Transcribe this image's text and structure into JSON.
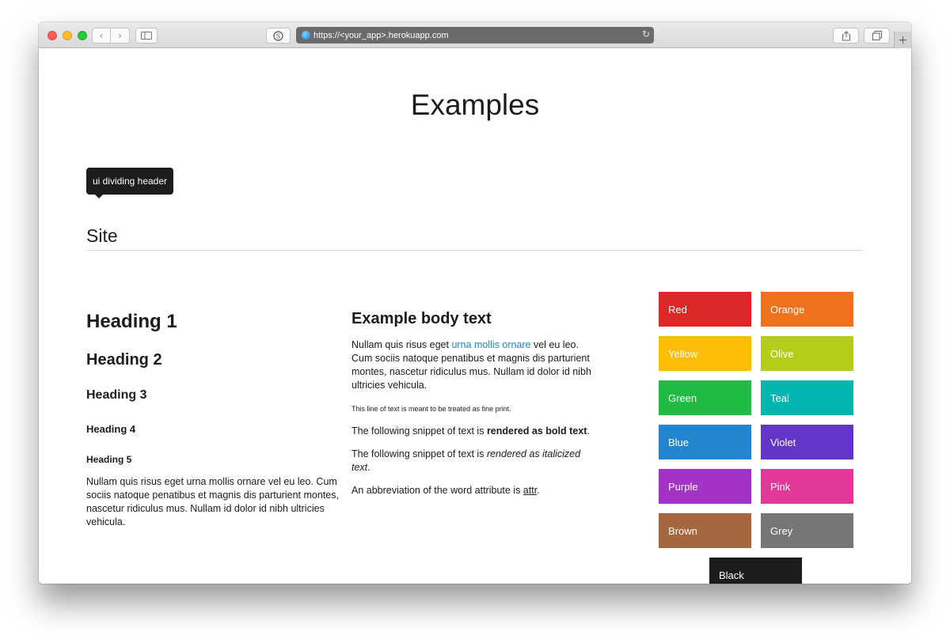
{
  "browser": {
    "url": "https://<your_app>.herokuapp.com"
  },
  "page": {
    "title": "Examples",
    "tooltip": "ui dividing header",
    "section_header": "Site"
  },
  "headings": {
    "h1": "Heading 1",
    "h2": "Heading 2",
    "h3": "Heading 3",
    "h4": "Heading 4",
    "h5": "Heading 5",
    "paragraph": "Nullam quis risus eget urna mollis ornare vel eu leo. Cum sociis natoque penatibus et magnis dis parturient montes, nascetur ridiculus mus. Nullam id dolor id nibh ultricies vehicula."
  },
  "body_text": {
    "title": "Example body text",
    "p1_before": "Nullam quis risus eget ",
    "p1_link": "urna mollis ornare",
    "p1_after": " vel eu leo. Cum sociis natoque penatibus et magnis dis parturient montes, nascetur ridiculus mus. Nullam id dolor id nibh ultricies vehicula.",
    "fine_print": "This line of text is meant to be treated as fine print.",
    "bold_before": "The following snippet of text is ",
    "bold_text": "rendered as bold text",
    "bold_after": ".",
    "italic_before": "The following snippet of text is ",
    "italic_text": "rendered as italicized text",
    "italic_after": ".",
    "abbr_before": "An abbreviation of the word attribute is ",
    "abbr_text": "attr",
    "abbr_after": "."
  },
  "colors": [
    {
      "label": "Red",
      "color": "#db2828"
    },
    {
      "label": "Orange",
      "color": "#f2711c"
    },
    {
      "label": "Yellow",
      "color": "#fbbd08"
    },
    {
      "label": "Olive",
      "color": "#b5cc18"
    },
    {
      "label": "Green",
      "color": "#21ba45"
    },
    {
      "label": "Teal",
      "color": "#00b5ad"
    },
    {
      "label": "Blue",
      "color": "#2185d0"
    },
    {
      "label": "Violet",
      "color": "#6435c9"
    },
    {
      "label": "Purple",
      "color": "#a333c8"
    },
    {
      "label": "Pink",
      "color": "#e03997"
    },
    {
      "label": "Brown",
      "color": "#a5673f"
    },
    {
      "label": "Grey",
      "color": "#767676"
    },
    {
      "label": "Black",
      "color": "#1b1c1d"
    }
  ]
}
